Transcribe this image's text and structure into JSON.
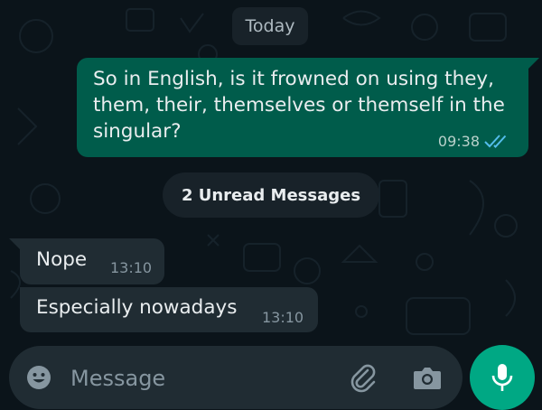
{
  "conversation": {
    "date_chip": "Today",
    "outgoing_message": {
      "text": "So in English, is it frowned on using they, them, their, themselves or themself in the singular?",
      "time": "09:38",
      "status_icon": "double-check-read-icon"
    },
    "unread_chip": "2 Unread Messages",
    "incoming_messages": [
      {
        "text": "Nope",
        "time": "13:10"
      },
      {
        "text": "Especially nowadays",
        "time": "13:10"
      }
    ]
  },
  "composer": {
    "placeholder": "Message",
    "emoji_icon": "emoji-icon",
    "attach_icon": "paperclip-icon",
    "camera_icon": "camera-icon",
    "mic_icon": "microphone-icon"
  },
  "colors": {
    "background": "#0b141a",
    "outgoing_bubble": "#005c4b",
    "incoming_bubble": "#202c33",
    "accent": "#00a884",
    "read_ticks": "#53bdeb"
  }
}
